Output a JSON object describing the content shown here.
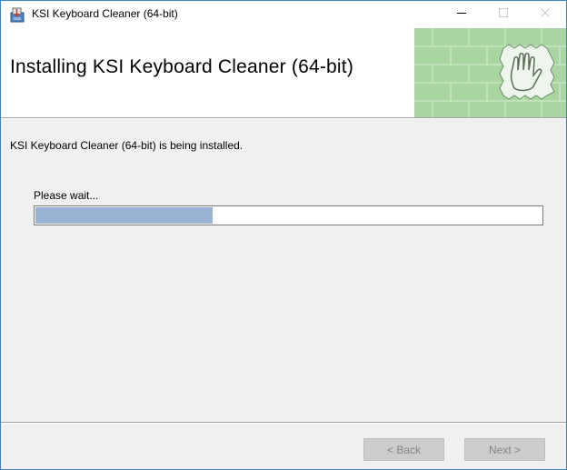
{
  "window": {
    "title": "KSI Keyboard Cleaner (64-bit)",
    "icons": [
      "installer-icon",
      "minimize-icon",
      "maximize-icon",
      "close-icon"
    ]
  },
  "banner": {
    "heading": "Installing KSI Keyboard Cleaner (64-bit)",
    "art": "green-brick-wall-with-hand-stamp"
  },
  "content": {
    "status_text": "KSI Keyboard Cleaner (64-bit) is being installed.",
    "wait_label": "Please wait...",
    "progress_percent": 35
  },
  "footer": {
    "back_label": "< Back",
    "next_label": "Next >"
  },
  "colors": {
    "progress_fill": "#9ab3d5",
    "banner_green": "#a8d5a0",
    "window_border": "#3c83c4"
  }
}
